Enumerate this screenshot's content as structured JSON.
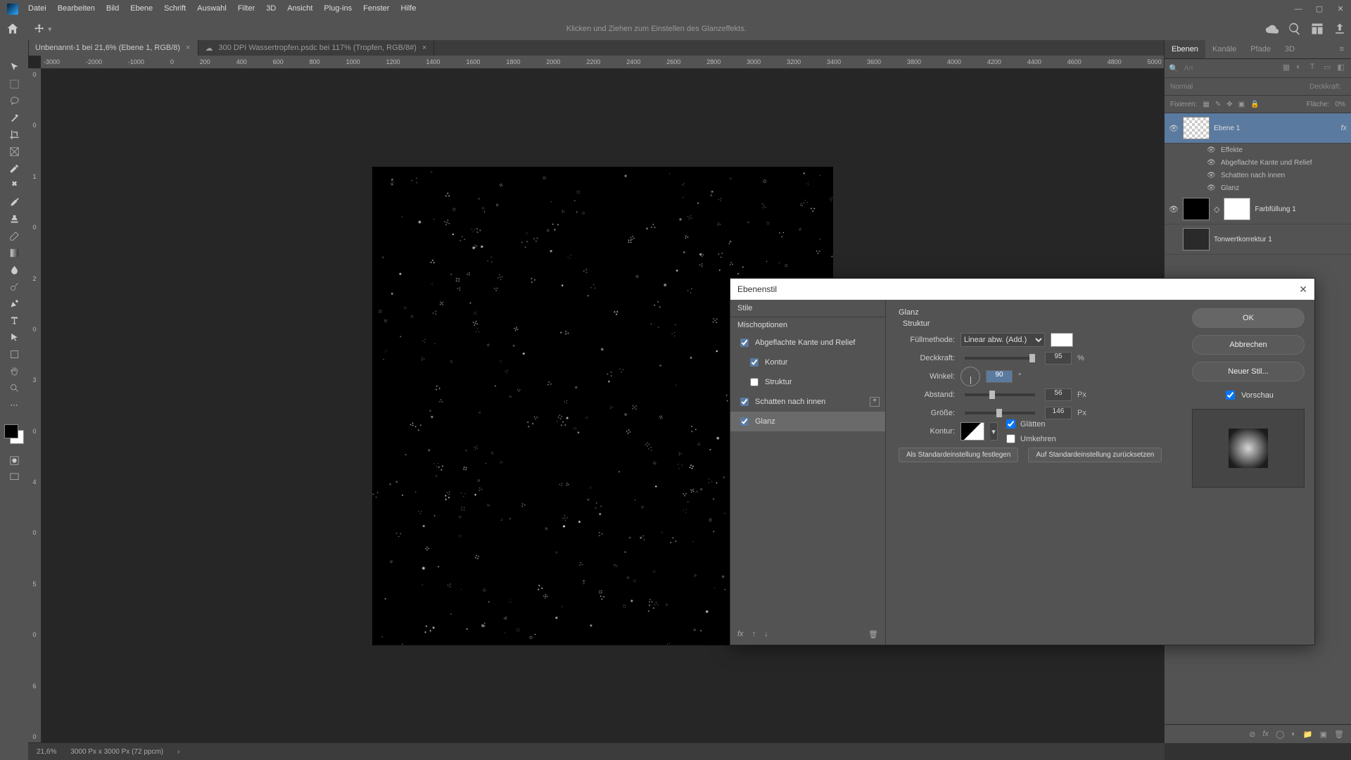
{
  "menu": [
    "Datei",
    "Bearbeiten",
    "Bild",
    "Ebene",
    "Schrift",
    "Auswahl",
    "Filter",
    "3D",
    "Ansicht",
    "Plug-ins",
    "Fenster",
    "Hilfe"
  ],
  "optionsHint": "Klicken und Ziehen zum Einstellen des Glanzeffekts.",
  "tabs": [
    {
      "label": "Unbenannt-1 bei 21,6% (Ebene 1, RGB/8)"
    },
    {
      "label": "300 DPI Wassertropfen.psdc bei 117% (Tropfen, RGB/8#)"
    }
  ],
  "ruler_h": [
    "-3000",
    "-2000",
    "-1000",
    "0",
    "200",
    "400",
    "600",
    "800",
    "1000",
    "1200",
    "1400",
    "1600",
    "1800",
    "2000",
    "2200",
    "2400",
    "2600",
    "2800",
    "3000",
    "3200",
    "3400",
    "3600",
    "3800",
    "4000",
    "4200",
    "4400",
    "4600",
    "4800",
    "5000"
  ],
  "ruler_v": [
    "0",
    "0",
    "1",
    "0",
    "2",
    "0",
    "3",
    "0",
    "4",
    "0",
    "5",
    "0",
    "6",
    "0"
  ],
  "panel": {
    "tabs": [
      "Ebenen",
      "Kanäle",
      "Pfade",
      "3D"
    ],
    "search_ph": "Art",
    "blendmode": "Normal",
    "opacity_lbl": "Deckkraft:",
    "opacity": "",
    "lock_lbl": "Fixieren:",
    "fill_lbl": "Fläche:",
    "fill": "0%",
    "layers": [
      {
        "name": "Ebene 1",
        "fx": true,
        "sel": true
      },
      {
        "name": "Farbfüllung 1"
      },
      {
        "name": "Tonwertkorrektur 1"
      }
    ],
    "fx_lbl": "Effekte",
    "fx_items": [
      "Abgeflachte Kante und Relief",
      "Schatten nach innen",
      "Glanz"
    ]
  },
  "status": {
    "zoom": "21,6%",
    "dims": "3000 Px x 3000 Px (72 ppcm)"
  },
  "dlg": {
    "title": "Ebenenstil",
    "styles_hdr": "Stile",
    "styles": [
      {
        "label": "Mischoptionen",
        "cb": false
      },
      {
        "label": "Abgeflachte Kante und Relief",
        "cb": true,
        "checked": true
      },
      {
        "label": "Kontur",
        "cb": true,
        "checked": true,
        "sub": true
      },
      {
        "label": "Struktur",
        "cb": true,
        "checked": false,
        "sub": true
      },
      {
        "label": "Schatten nach innen",
        "cb": true,
        "checked": true,
        "plus": true
      },
      {
        "label": "Glanz",
        "cb": true,
        "checked": true,
        "sel": true
      }
    ],
    "group_title": "Glanz",
    "group_sub": "Struktur",
    "blend_lbl": "Füllmethode:",
    "blend_val": "Linear abw. (Add.)",
    "opacity_lbl": "Deckkraft:",
    "opacity_val": "95",
    "opacity_unit": "%",
    "angle_lbl": "Winkel:",
    "angle_val": "90",
    "angle_unit": "°",
    "dist_lbl": "Abstand:",
    "dist_val": "56",
    "dist_unit": "Px",
    "size_lbl": "Größe:",
    "size_val": "146",
    "size_unit": "Px",
    "contour_lbl": "Kontur:",
    "aa_lbl": "Glätten",
    "invert_lbl": "Umkehren",
    "defset": "Als Standardeinstellung festlegen",
    "defreset": "Auf Standardeinstellung zurücksetzen",
    "ok": "OK",
    "cancel": "Abbrechen",
    "newstyle": "Neuer Stil...",
    "preview": "Vorschau"
  }
}
